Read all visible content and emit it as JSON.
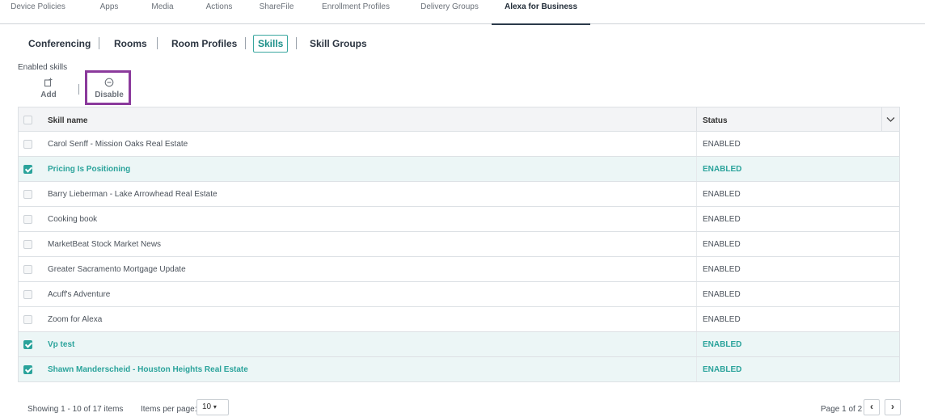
{
  "top_tabs": [
    {
      "label": "Device Policies"
    },
    {
      "label": "Apps"
    },
    {
      "label": "Media"
    },
    {
      "label": "Actions"
    },
    {
      "label": "ShareFile"
    },
    {
      "label": "Enrollment Profiles"
    },
    {
      "label": "Delivery Groups"
    },
    {
      "label": "Alexa for Business"
    }
  ],
  "active_top_tab": "Alexa for Business",
  "sub_tabs": [
    {
      "label": "Conferencing"
    },
    {
      "label": "Rooms"
    },
    {
      "label": "Room Profiles"
    },
    {
      "label": "Skills"
    },
    {
      "label": "Skill Groups"
    }
  ],
  "active_sub_tab": "Skills",
  "section": {
    "label": "Enabled skills"
  },
  "toolbar": {
    "add": {
      "icon": "add-icon",
      "label": "Add"
    },
    "disable": {
      "icon": "disable-icon",
      "label": "Disable"
    }
  },
  "table": {
    "columns": [
      "Skill name",
      "Status"
    ],
    "rows": [
      {
        "name": "Carol Senff - Mission Oaks Real Estate",
        "status": "ENABLED",
        "checked": false
      },
      {
        "name": "Pricing Is Positioning",
        "status": "ENABLED",
        "checked": true
      },
      {
        "name": "Barry Lieberman - Lake Arrowhead Real Estate",
        "status": "ENABLED",
        "checked": false
      },
      {
        "name": "Cooking book",
        "status": "ENABLED",
        "checked": false
      },
      {
        "name": "MarketBeat Stock Market News",
        "status": "ENABLED",
        "checked": false
      },
      {
        "name": "Greater Sacramento Mortgage Update",
        "status": "ENABLED",
        "checked": false
      },
      {
        "name": "Acuff's Adventure",
        "status": "ENABLED",
        "checked": false
      },
      {
        "name": "Zoom for Alexa",
        "status": "ENABLED",
        "checked": false
      },
      {
        "name": "Vp test",
        "status": "ENABLED",
        "checked": true
      },
      {
        "name": "Shawn Manderscheid - Houston Heights Real Estate",
        "status": "ENABLED",
        "checked": true
      }
    ]
  },
  "footer": {
    "showing": "Showing 1 - 10 of 17 items",
    "items_per_page_label": "Items per page:",
    "items_per_page_value": "10",
    "page_text": "Page 1 of 2"
  },
  "colors": {
    "accent": "#2aa39b",
    "highlight_box": "#8b3a9c",
    "selected_row_bg": "#ecf6f6"
  }
}
